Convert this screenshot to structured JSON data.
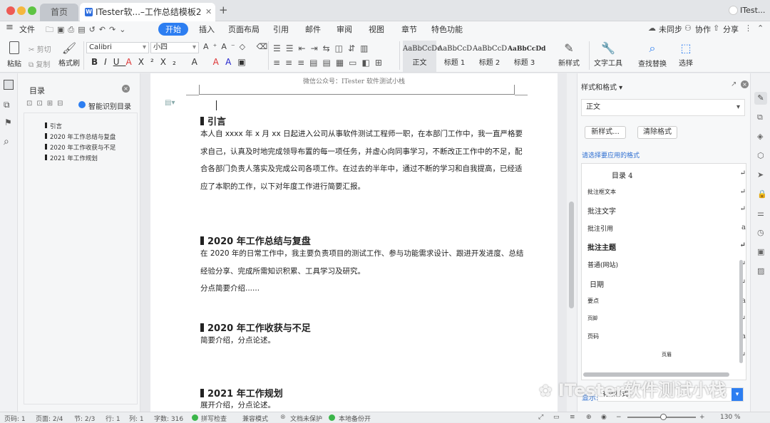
{
  "window": {
    "tab_home": "首页",
    "tab_doc": "ITester软...–工作总结模板2",
    "user": "ITest..."
  },
  "menu": {
    "file": "文件",
    "items": [
      "开始",
      "插入",
      "页面布局",
      "引用",
      "邮件",
      "审阅",
      "视图",
      "章节",
      "特色功能"
    ],
    "active": "开始",
    "sync": "未同步",
    "collab": "协作",
    "share": "分享"
  },
  "ribbon": {
    "paste": "粘贴",
    "cut": "剪切",
    "copy": "复制",
    "format_painter": "格式刷",
    "font": "Calibri",
    "size": "小四",
    "styles": [
      {
        "preview": "AaBbCcDc",
        "name": "正文"
      },
      {
        "preview": "AaBbCcD",
        "name": "标题 1"
      },
      {
        "preview": "AaBbCcD",
        "name": "标题 2"
      },
      {
        "preview": "AaBbCcDd",
        "name": "标题 3"
      }
    ],
    "new_style": "新样式",
    "text_tools": "文字工具",
    "find_replace": "查找替换",
    "select": "选择"
  },
  "nav": {
    "title": "目录",
    "smart": "智能识别目录",
    "items": [
      "引言",
      "2020 年工作总结与复盘",
      "2020 年工作收获与不足",
      "2021 年工作规划"
    ]
  },
  "doc": {
    "header": "微信公众号：ITester 软件测试小栈",
    "sections": [
      {
        "heading": "引言",
        "lines": [
          "本人自 xxxx 年 x 月 xx 日起进入公司从事软件测试工程师一职，在本部门工作中，我一直严格要",
          "求自己，认真及时地完成领导布置的每一项任务，并虚心向同事学习，不断改正工作中的不足，配",
          "合各部门负责人落实及完成公司各项工作。在过去的半年中，通过不断的学习和自我提高，已经适",
          "应了本职的工作，以下对年度工作进行简要汇报。"
        ]
      },
      {
        "heading": "2020 年工作总结与复盘",
        "lines": [
          "在 2020 年的日常工作中，我主要负责项目的测试工作、参与功能需求设计、跟进开发进度、总结",
          "经验分享、完成所需知识积累、工具学习及研究。",
          "分点简要介绍......"
        ]
      },
      {
        "heading": "2020 年工作收获与不足",
        "lines": [
          "简要介绍，分点论述。"
        ]
      },
      {
        "heading": "2021 年工作规划",
        "lines": [
          "展开介绍，分点论述。"
        ]
      }
    ]
  },
  "styles_panel": {
    "title": "样式和格式",
    "current": "正文",
    "new_btn": "新样式...",
    "clear_btn": "清除格式",
    "hint": "请选择要应用的格式",
    "items": [
      "目录 4",
      "批注框文本",
      "批注文字",
      "批注引用",
      "批注主题",
      "普通(网站)",
      "日期",
      "要点",
      "页脚",
      "页码",
      "页眉"
    ],
    "show_label": "显示:",
    "show_value": "有效样式"
  },
  "watermark": "ITester软件测试小栈",
  "status": {
    "page_num": "页码: 1",
    "pages": "页面: 2/4",
    "section": "节: 2/3",
    "row": "行: 1",
    "col": "列: 1",
    "words": "字数: 316",
    "spell": "拼写检查",
    "compat": "兼容模式",
    "protect": "文档未保护",
    "backup": "本地备份开",
    "zoom": "130 %",
    "zoom_level": 0.55
  }
}
